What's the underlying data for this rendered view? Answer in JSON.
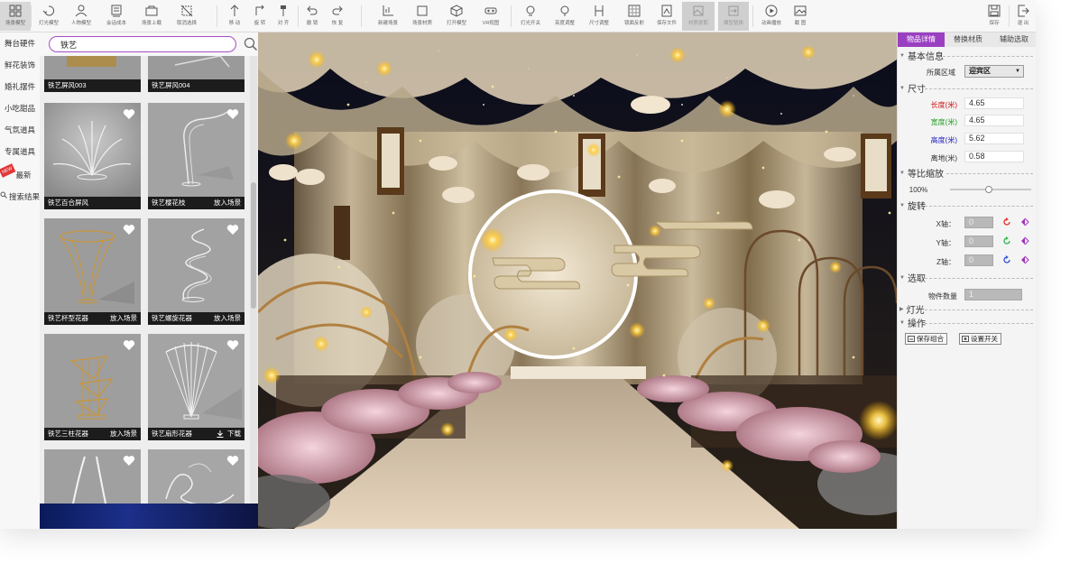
{
  "toolbar": {
    "buttons": [
      {
        "label": "场景模型",
        "icon": "grid-icon"
      },
      {
        "label": "灯光模型",
        "icon": "lamp-icon"
      },
      {
        "label": "人物模型",
        "icon": "person-icon"
      },
      {
        "label": "会话成本",
        "icon": "document-icon"
      },
      {
        "label": "场景上载",
        "icon": "box-icon"
      },
      {
        "label": "取消选择",
        "icon": "deselect-icon"
      },
      {
        "label": "移 动",
        "icon": "move-icon"
      },
      {
        "label": "旋 转",
        "icon": "rotate-icon"
      },
      {
        "label": "对 齐",
        "icon": "pin-icon"
      },
      {
        "label": "撤 销",
        "icon": "undo-icon"
      },
      {
        "label": "恢 复",
        "icon": "redo-icon"
      },
      {
        "label": "新建场景",
        "icon": "axes-icon"
      },
      {
        "label": "场景材质",
        "icon": "square-icon"
      },
      {
        "label": "打开模型",
        "icon": "cube-icon"
      },
      {
        "label": "VR视图",
        "icon": "vr-icon"
      },
      {
        "label": "灯光开关",
        "icon": "bulb-icon"
      },
      {
        "label": "亮度调整",
        "icon": "bulb-outline-icon"
      },
      {
        "label": "尺寸调整",
        "icon": "resize-icon"
      },
      {
        "label": "镜面反射",
        "icon": "mirror-icon"
      },
      {
        "label": "保存文件",
        "icon": "save-file-icon"
      },
      {
        "label": "材质提取",
        "icon": "material-icon"
      },
      {
        "label": "模型替换",
        "icon": "replace-icon"
      },
      {
        "label": "动画播放",
        "icon": "play-icon"
      },
      {
        "label": "截 图",
        "icon": "image-icon"
      },
      {
        "label": "保存",
        "icon": "disk-icon"
      },
      {
        "label": "退 出",
        "icon": "exit-icon"
      }
    ]
  },
  "categories": [
    {
      "label": "舞台硬件"
    },
    {
      "label": "鲜花装饰"
    },
    {
      "label": "婚礼摆件"
    },
    {
      "label": "小吃甜品"
    },
    {
      "label": "气氛道具"
    },
    {
      "label": "专属道具"
    },
    {
      "label": "最新",
      "badge": "NEW"
    },
    {
      "label": "搜索结果"
    }
  ],
  "search": {
    "value": "铁艺"
  },
  "grid": {
    "items": [
      {
        "name": "铁艺屏风003",
        "action": ""
      },
      {
        "name": "铁艺屏风004",
        "action": ""
      },
      {
        "name": "铁艺百合屏风",
        "action": ""
      },
      {
        "name": "铁艺樱花枝",
        "action": "放入场景"
      },
      {
        "name": "铁艺杯型花器",
        "action": "放入场景"
      },
      {
        "name": "铁艺螺旋花器",
        "action": "放入场景"
      },
      {
        "name": "铁艺三柱花器",
        "action": "放入场景"
      },
      {
        "name": "铁艺扇形花器",
        "action": "下载"
      },
      {
        "name": "",
        "action": ""
      },
      {
        "name": "",
        "action": ""
      }
    ]
  },
  "panel": {
    "tabs": [
      "物品详情",
      "替换材质",
      "辅助选取"
    ],
    "basic": {
      "title": "基本信息",
      "region_label": "所属区域",
      "region_value": "迎宾区"
    },
    "size": {
      "title": "尺寸",
      "length_label": "长度(米)",
      "length_value": "4.65",
      "width_label": "宽度(米)",
      "width_value": "4.65",
      "height_label": "高度(米)",
      "height_value": "5.62",
      "ground_label": "离地(米)",
      "ground_value": "0.58"
    },
    "scale": {
      "title": "等比缩放",
      "value": "100%",
      "level": 0.48
    },
    "rotate": {
      "title": "旋转",
      "x_label": "X轴：",
      "x_value": "0",
      "y_label": "Y轴：",
      "y_value": "0",
      "z_label": "Z轴：",
      "z_value": "0"
    },
    "select": {
      "title": "选取",
      "count_label": "物件数量",
      "count_value": "1"
    },
    "light": {
      "title": "灯光"
    },
    "ops": {
      "title": "操作",
      "save_group": "保存组合",
      "set_switch": "设置开关"
    }
  },
  "colors": {
    "accent": "#9b3fc2",
    "length": "#d01010",
    "width": "#20a020",
    "height": "#2020c0",
    "rot_red": "#e0302a",
    "rot_green": "#2db84a",
    "rot_blue": "#3050d0",
    "rot_purple": "#a030c0"
  }
}
